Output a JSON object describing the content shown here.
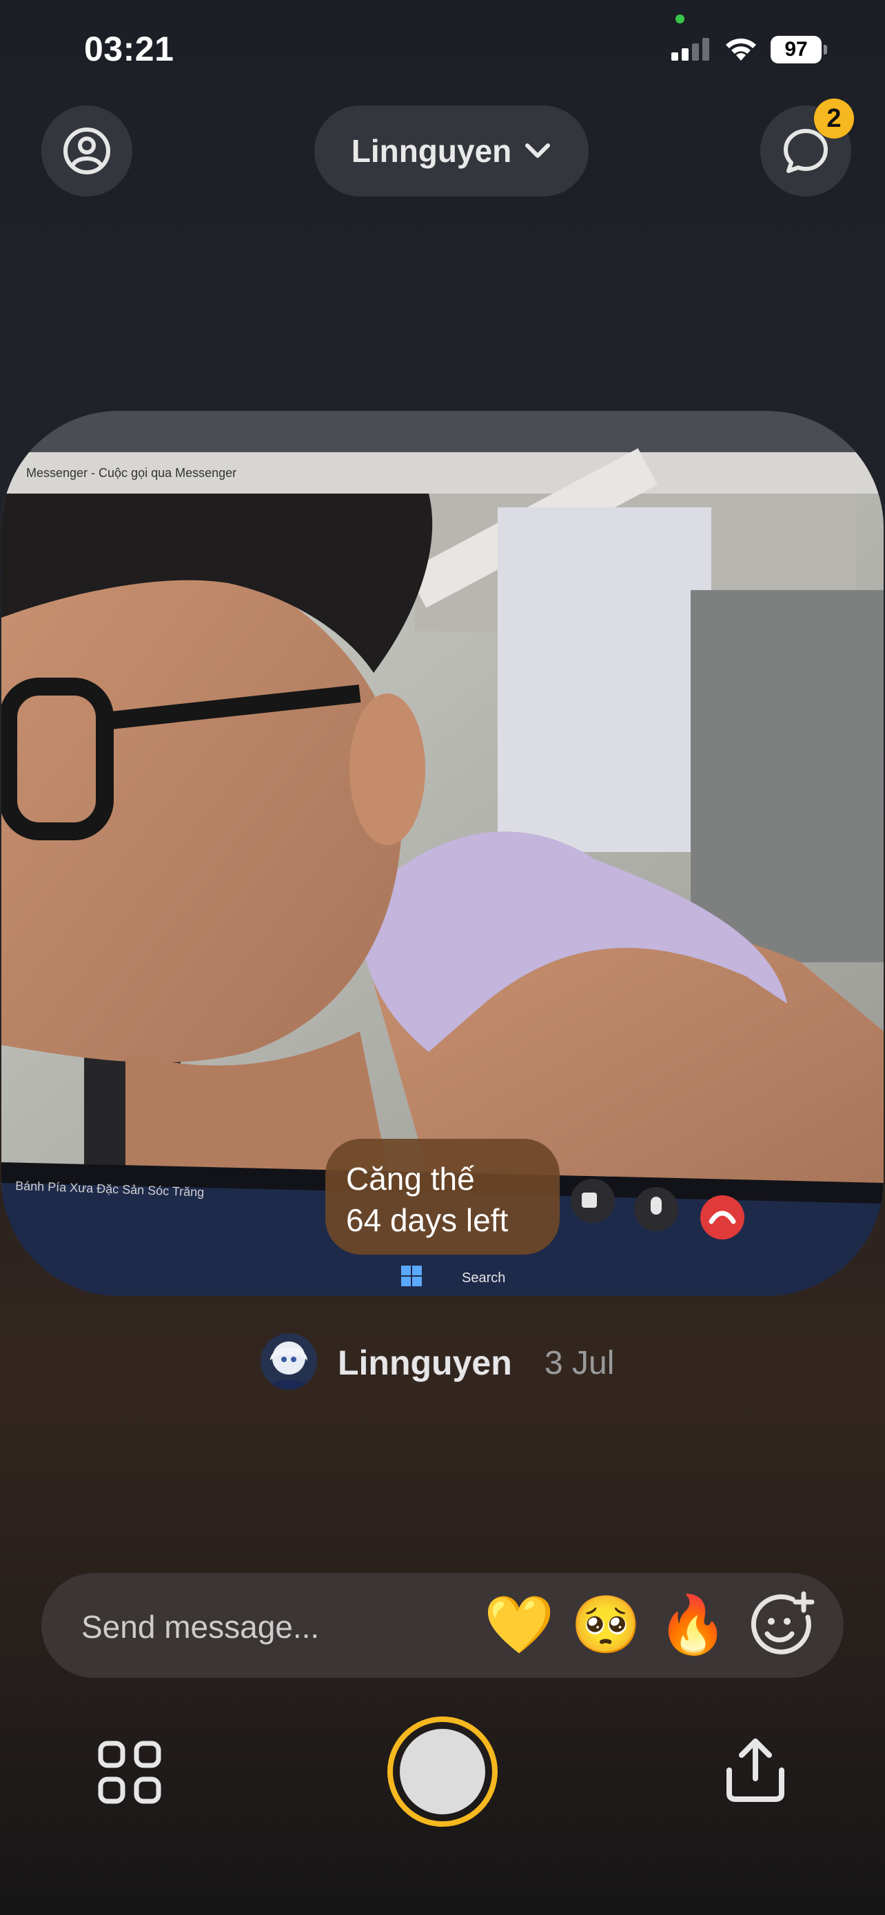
{
  "status_bar": {
    "time": "03:21",
    "battery": "97"
  },
  "header": {
    "profile_icon": "person-circle-icon",
    "friend_selector": {
      "label": "Linnguyen",
      "icon": "chevron-down-icon"
    },
    "chat_icon": "chat-bubble-icon",
    "unread_count": "2"
  },
  "post": {
    "caption_line1": "Căng thế",
    "caption_line2": "64 days left",
    "author": "Linnguyen",
    "date": "3 Jul",
    "photo_titlebar": "Messenger - Cuộc gọi qua Messenger",
    "photo_taskbar_text": "Bánh Pía Xưa Đặc Sản Sóc Trăng",
    "photo_search": "Search"
  },
  "composer": {
    "placeholder": "Send message...",
    "reactions": [
      "💛",
      "🥺",
      "🔥"
    ],
    "add_reaction_icon": "smiley-plus-icon"
  },
  "bottom_bar": {
    "grid_icon": "grid-icon",
    "shutter": "capture-button",
    "share_icon": "share-icon"
  },
  "colors": {
    "accent": "#f5b81f",
    "badge": "#f7b71e",
    "caption_bg": "#6e4828",
    "end_call": "#e03a3a"
  }
}
